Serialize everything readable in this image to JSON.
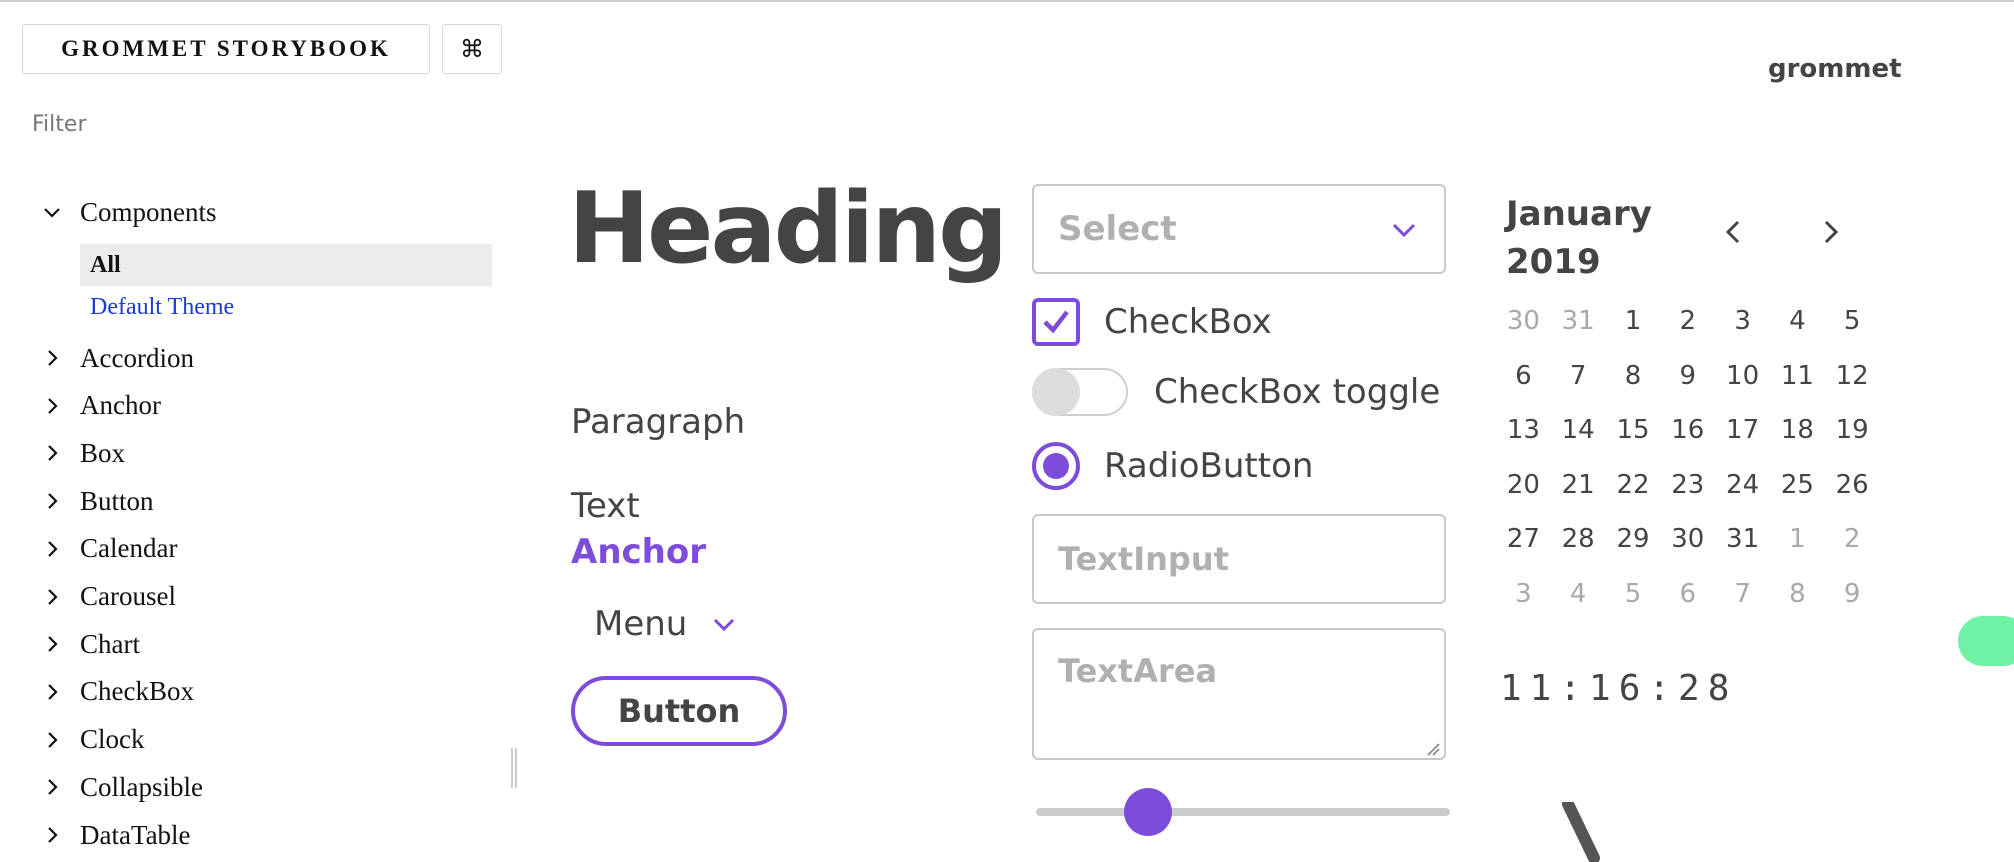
{
  "sidebar": {
    "title": "GROMMET STORYBOOK",
    "shortcut_glyph": "⌘",
    "filter_placeholder": "Filter",
    "tree": {
      "root_label": "Components",
      "children": [
        {
          "label": "All",
          "selected": true
        },
        {
          "label": "Default Theme",
          "selected": false
        }
      ],
      "items": [
        "Accordion",
        "Anchor",
        "Box",
        "Button",
        "Calendar",
        "Carousel",
        "Chart",
        "CheckBox",
        "Clock",
        "Collapsible",
        "DataTable"
      ]
    }
  },
  "main": {
    "brand": "grommet",
    "heading": "Heading",
    "paragraph": "Paragraph",
    "text": "Text",
    "anchor": "Anchor",
    "menu_label": "Menu",
    "button_label": "Button",
    "select_placeholder": "Select",
    "checkbox_label": "CheckBox",
    "checkbox_checked": true,
    "toggle_label": "CheckBox toggle",
    "toggle_on": false,
    "radio_label": "RadioButton",
    "radio_selected": true,
    "textinput_placeholder": "TextInput",
    "textarea_placeholder": "TextArea",
    "slider_value_fraction": 0.27,
    "calendar": {
      "month_line1": "January",
      "month_line2": "2019",
      "weeks": [
        [
          {
            "d": "30",
            "m": true
          },
          {
            "d": "31",
            "m": true
          },
          {
            "d": "1"
          },
          {
            "d": "2"
          },
          {
            "d": "3"
          },
          {
            "d": "4"
          },
          {
            "d": "5"
          }
        ],
        [
          {
            "d": "6"
          },
          {
            "d": "7"
          },
          {
            "d": "8"
          },
          {
            "d": "9"
          },
          {
            "d": "10"
          },
          {
            "d": "11"
          },
          {
            "d": "12"
          }
        ],
        [
          {
            "d": "13"
          },
          {
            "d": "14"
          },
          {
            "d": "15"
          },
          {
            "d": "16"
          },
          {
            "d": "17"
          },
          {
            "d": "18"
          },
          {
            "d": "19"
          }
        ],
        [
          {
            "d": "20"
          },
          {
            "d": "21"
          },
          {
            "d": "22"
          },
          {
            "d": "23"
          },
          {
            "d": "24"
          },
          {
            "d": "25"
          },
          {
            "d": "26"
          }
        ],
        [
          {
            "d": "27"
          },
          {
            "d": "28"
          },
          {
            "d": "29"
          },
          {
            "d": "30"
          },
          {
            "d": "31"
          },
          {
            "d": "1",
            "m": true
          },
          {
            "d": "2",
            "m": true
          }
        ],
        [
          {
            "d": "3",
            "m": true
          },
          {
            "d": "4",
            "m": true
          },
          {
            "d": "5",
            "m": true
          },
          {
            "d": "6",
            "m": true
          },
          {
            "d": "7",
            "m": true
          },
          {
            "d": "8",
            "m": true
          },
          {
            "d": "9",
            "m": true
          }
        ]
      ]
    },
    "clock_text": "11:16:28"
  },
  "colors": {
    "brand": "#7d4cdb",
    "text": "#444444",
    "accent_green": "#6ff2a8",
    "link_blue": "#1a3cd6"
  }
}
